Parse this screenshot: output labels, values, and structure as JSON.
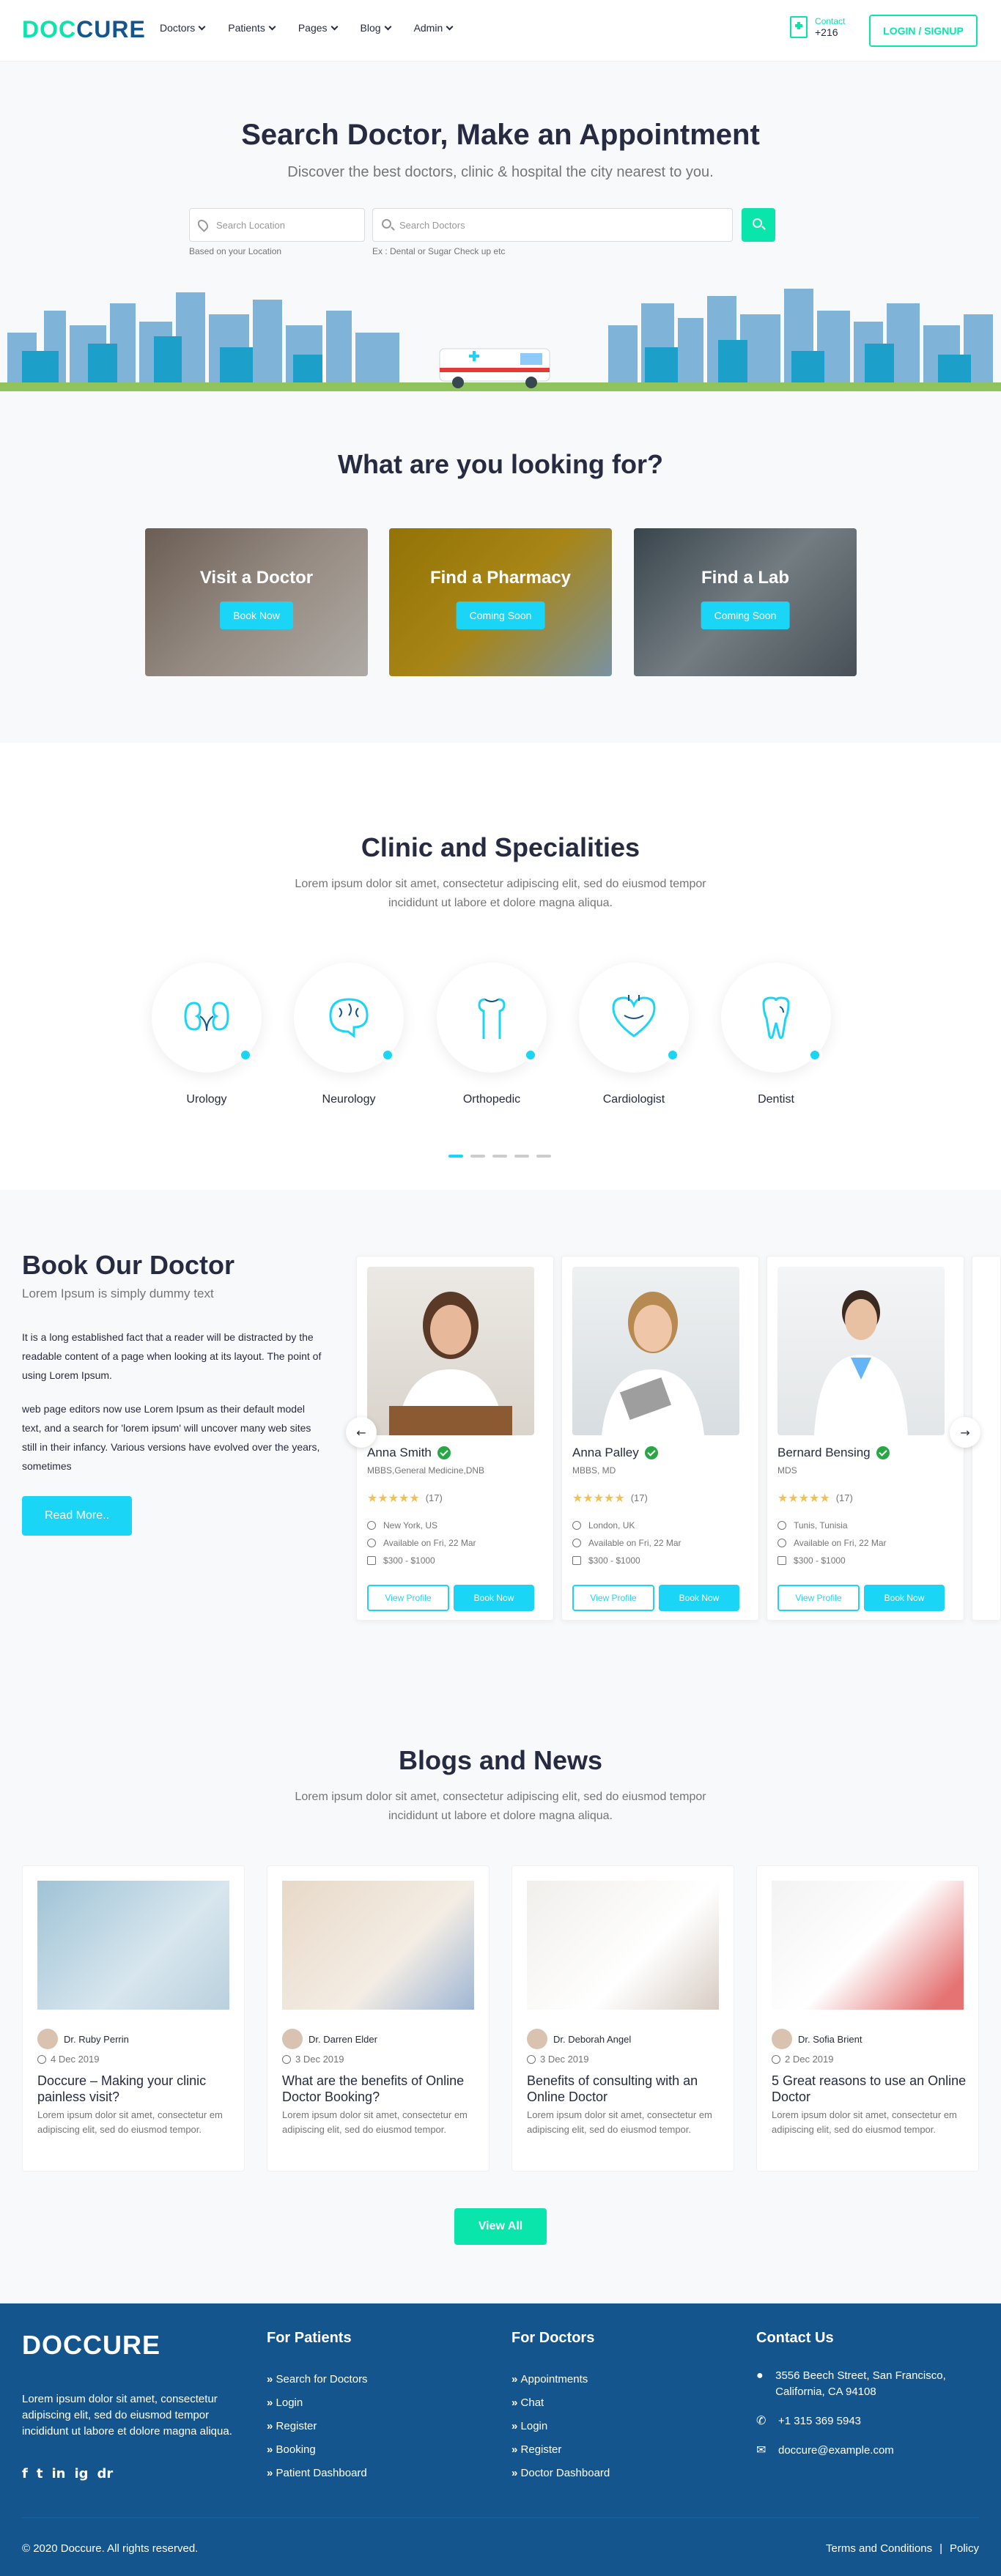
{
  "header": {
    "logo_part1": "DOC",
    "logo_part2": "CURE",
    "nav": [
      "Doctors",
      "Patients",
      "Pages",
      "Blog",
      "Admin"
    ],
    "contact_label": "Contact",
    "contact_number": "+216",
    "login_label": "LOGIN / SIGNUP"
  },
  "hero": {
    "title": "Search Doctor, Make an Appointment",
    "subtitle": "Discover the best doctors, clinic & hospital the city nearest to you.",
    "location_placeholder": "Search Location",
    "doctor_placeholder": "Search Doctors",
    "location_hint": "Based on your Location",
    "doctor_hint": "Ex : Dental or Sugar Check up etc"
  },
  "looking": {
    "title": "What are you looking for?",
    "cards": [
      {
        "title": "Visit a Doctor",
        "button": "Book Now"
      },
      {
        "title": "Find a Pharmacy",
        "button": "Coming Soon"
      },
      {
        "title": "Find a Lab",
        "button": "Coming Soon"
      }
    ]
  },
  "specialities": {
    "title": "Clinic and Specialities",
    "subtitle": "Lorem ipsum dolor sit amet, consectetur adipiscing elit, sed do eiusmod tempor incididunt ut labore et dolore magna aliqua.",
    "items": [
      "Urology",
      "Neurology",
      "Orthopedic",
      "Cardiologist",
      "Dentist"
    ]
  },
  "book": {
    "title": "Book Our Doctor",
    "subtitle": "Lorem Ipsum is simply dummy text",
    "para1": "It is a long established fact that a reader will be distracted by the readable content of a page when looking at its layout. The point of using Lorem Ipsum.",
    "para2": "web page editors now use Lorem Ipsum as their default model text, and a search for 'lorem ipsum' will uncover many web sites still in their infancy. Various versions have evolved over the years, sometimes",
    "read_more": "Read More..",
    "doctors": [
      {
        "name": "Anna Smith",
        "spec": "MBBS,General Medicine,DNB",
        "rating_count": "(17)",
        "location": "New York, US",
        "available": "Available on Fri, 22 Mar",
        "price": "$300 - $1000",
        "view": "View Profile",
        "book": "Book Now"
      },
      {
        "name": "Anna Palley",
        "spec": "MBBS, MD",
        "rating_count": "(17)",
        "location": "London, UK",
        "available": "Available on Fri, 22 Mar",
        "price": "$300 - $1000",
        "view": "View Profile",
        "book": "Book Now"
      },
      {
        "name": "Bernard Bensing",
        "spec": "MDS",
        "rating_count": "(17)",
        "location": "Tunis, Tunisia",
        "available": "Available on Fri, 22 Mar",
        "price": "$300 - $1000",
        "view": "View Profile",
        "book": "Book Now"
      }
    ]
  },
  "blogs": {
    "title": "Blogs and News",
    "subtitle": "Lorem ipsum dolor sit amet, consectetur adipiscing elit, sed do eiusmod tempor incididunt ut labore et dolore magna aliqua.",
    "items": [
      {
        "author": "Dr. Ruby Perrin",
        "date": "4 Dec 2019",
        "title": "Doccure – Making your clinic painless visit?",
        "text": "Lorem ipsum dolor sit amet, consectetur em adipiscing elit, sed do eiusmod tempor."
      },
      {
        "author": "Dr. Darren Elder",
        "date": "3 Dec 2019",
        "title": "What are the benefits of Online Doctor Booking?",
        "text": "Lorem ipsum dolor sit amet, consectetur em adipiscing elit, sed do eiusmod tempor."
      },
      {
        "author": "Dr. Deborah Angel",
        "date": "3 Dec 2019",
        "title": "Benefits of consulting with an Online Doctor",
        "text": "Lorem ipsum dolor sit amet, consectetur em adipiscing elit, sed do eiusmod tempor."
      },
      {
        "author": "Dr. Sofia Brient",
        "date": "2 Dec 2019",
        "title": "5 Great reasons to use an Online Doctor",
        "text": "Lorem ipsum dolor sit amet, consectetur em adipiscing elit, sed do eiusmod tempor."
      }
    ],
    "view_all": "View All"
  },
  "footer": {
    "logo": "DOCCURE",
    "about": "Lorem ipsum dolor sit amet, consectetur adipiscing elit, sed do eiusmod tempor incididunt ut labore et dolore magna aliqua.",
    "social": [
      "f",
      "t",
      "in",
      "ig",
      "dr"
    ],
    "patients_title": "For Patients",
    "patients_links": [
      "Search for Doctors",
      "Login",
      "Register",
      "Booking",
      "Patient Dashboard"
    ],
    "doctors_title": "For Doctors",
    "doctors_links": [
      "Appointments",
      "Chat",
      "Login",
      "Register",
      "Doctor Dashboard"
    ],
    "contact_title": "Contact Us",
    "address": "3556 Beech Street, San Francisco, California, CA 94108",
    "phone": "+1 315 369 5943",
    "email": "doccure@example.com",
    "copyright": "© 2020 Doccure. All rights reserved.",
    "terms": "Terms and Conditions",
    "policy": "Policy"
  },
  "colors": {
    "primary": "#09e5ab",
    "accent": "#1bd5f7",
    "brand": "#15558d"
  }
}
